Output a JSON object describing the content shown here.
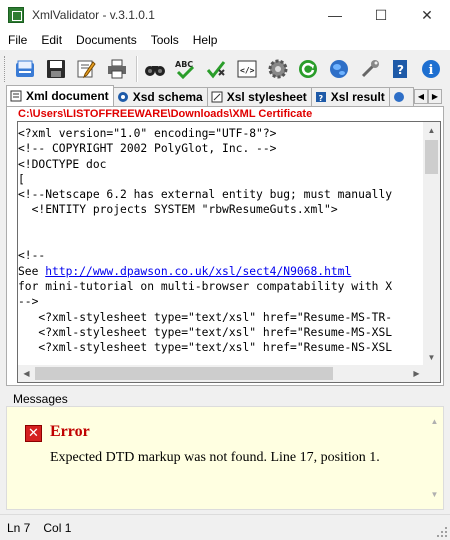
{
  "window": {
    "title": "XmlValidator - v.3.1.0.1",
    "minimize_glyph": "—",
    "maximize_glyph": "☐",
    "close_glyph": "✕"
  },
  "menu": [
    "File",
    "Edit",
    "Documents",
    "Tools",
    "Help"
  ],
  "toolbar": {
    "icons": [
      "new-file-icon",
      "save-icon",
      "edit-icon",
      "print-icon",
      "find-icon",
      "spellcheck-icon",
      "validate-icon",
      "xml-tag-icon",
      "settings-gear-icon",
      "refresh-icon",
      "globe-icon",
      "tools-icon",
      "help-book-icon",
      "info-icon"
    ]
  },
  "tabs": [
    {
      "label": "Xml document",
      "active": true
    },
    {
      "label": "Xsd schema",
      "active": false
    },
    {
      "label": "Xsl stylesheet",
      "active": false
    },
    {
      "label": "Xsl result",
      "active": false
    }
  ],
  "file_path": "C:\\Users\\LISTOFFREEWARE\\Downloads\\XML Certificate",
  "code": {
    "line1": "<?xml version=\"1.0\" encoding=\"UTF-8\"?>",
    "line2": "<!-- COPYRIGHT 2002 PolyGlot, Inc. -->",
    "line3": "<!DOCTYPE doc",
    "line4": "[",
    "line5": "<!--Netscape 6.2 has external entity bug; must manually",
    "line6": "  <!ENTITY projects SYSTEM \"rbwResumeGuts.xml\">",
    "line7": "",
    "line8": "",
    "line9": "<!--",
    "line10_prefix": "See ",
    "line10_link": "http://www.dpawson.co.uk/xsl/sect4/N9068.html",
    "line11": "for mini-tutorial on multi-browser compatability with X",
    "line12": "-->",
    "line13": "   <?xml-stylesheet type=\"text/xsl\" href=\"Resume-MS-TR-",
    "line14": "   <?xml-stylesheet type=\"text/xsl\" href=\"Resume-MS-XSL",
    "line15": "   <?xml-stylesheet type=\"text/xsl\" href=\"Resume-NS-XSL"
  },
  "messages": {
    "label": "Messages",
    "error_icon": "✕",
    "error_title": "Error",
    "error_text": "Expected DTD markup was not found. Line 17, position 1."
  },
  "status": {
    "line": "Ln 7",
    "col": "Col 1"
  },
  "colors": {
    "error_red": "#c00000",
    "path_red": "#e00000",
    "message_bg": "#ffffe1",
    "link_blue": "#0000ee"
  }
}
